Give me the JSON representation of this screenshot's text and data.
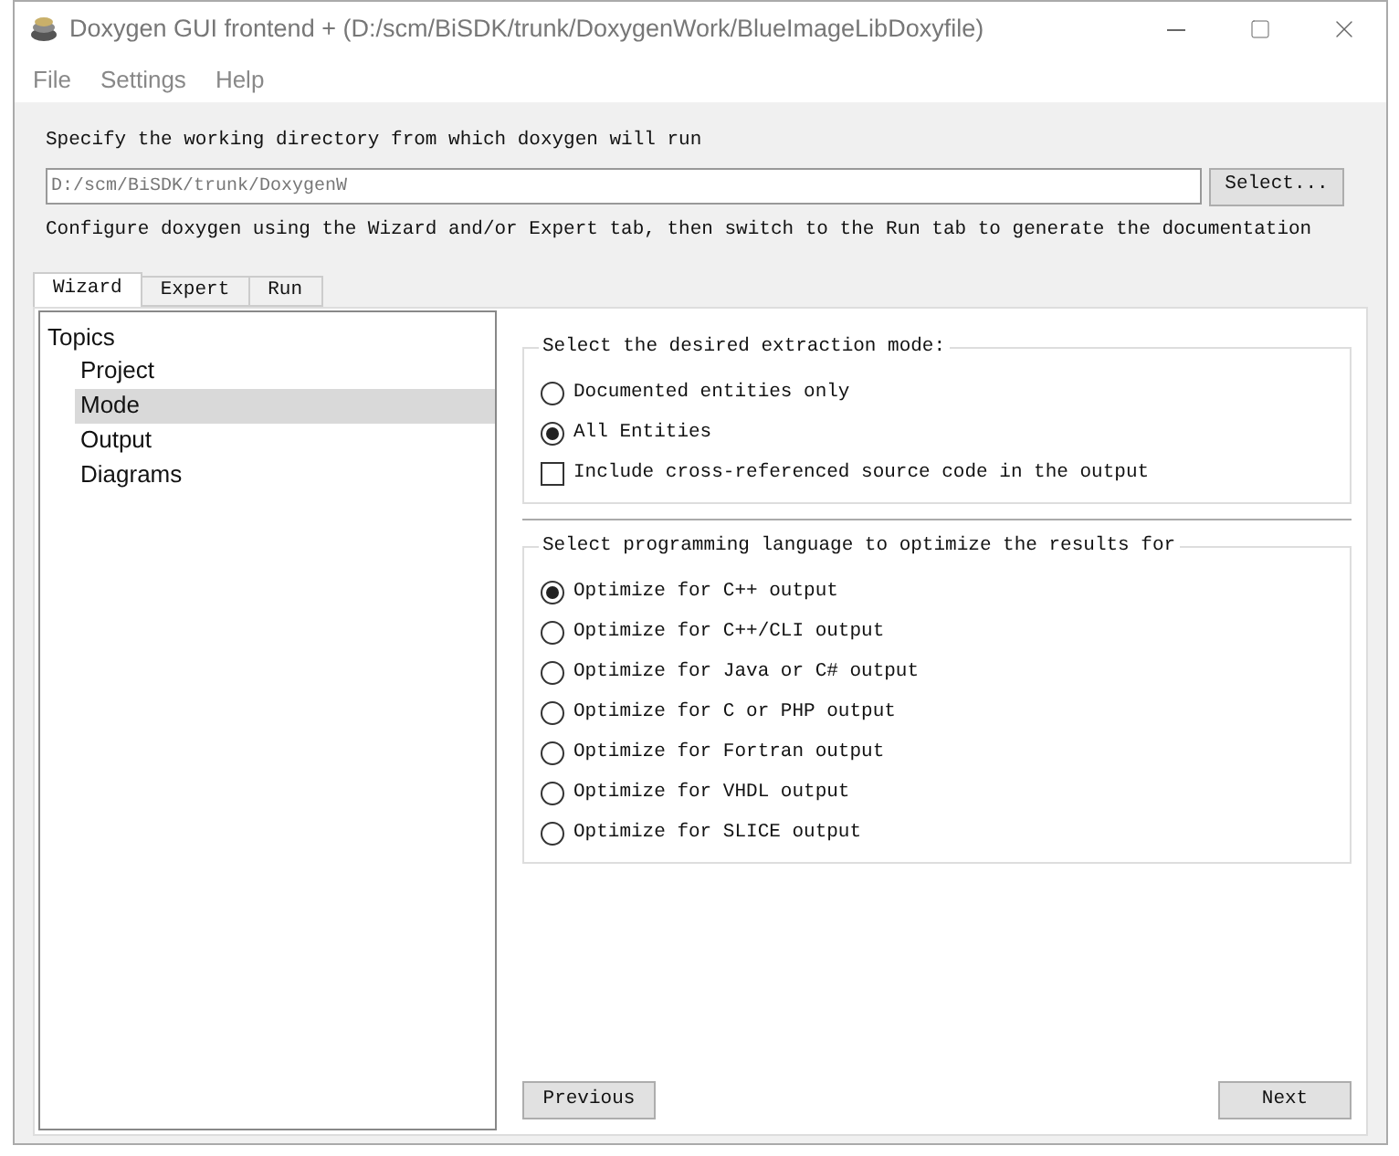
{
  "window": {
    "title": "Doxygen GUI frontend + (D:/scm/BiSDK/trunk/DoxygenWork/BlueImageLibDoxyfile)"
  },
  "menu": [
    "File",
    "Settings",
    "Help"
  ],
  "working_dir": {
    "label": "Specify the working directory from which doxygen will run",
    "value": "D:/scm/BiSDK/trunk/DoxygenW",
    "button": "Select..."
  },
  "hint": "Configure doxygen using the Wizard and/or Expert tab, then switch to the Run tab to generate the documentation",
  "tabs": [
    {
      "label": "Wizard",
      "selected": true
    },
    {
      "label": "Expert",
      "selected": false
    },
    {
      "label": "Run",
      "selected": false
    }
  ],
  "topics": {
    "title": "Topics",
    "items": [
      {
        "label": "Project",
        "selected": false
      },
      {
        "label": "Mode",
        "selected": true
      },
      {
        "label": "Output",
        "selected": false
      },
      {
        "label": "Diagrams",
        "selected": false
      }
    ]
  },
  "groups": [
    {
      "title": "Select the desired extraction mode:",
      "options": [
        {
          "kind": "radio",
          "label": "Documented entities only",
          "checked": false
        },
        {
          "kind": "radio",
          "label": "All Entities",
          "checked": true
        },
        {
          "kind": "checkbox",
          "label": "Include cross-referenced source code in the output",
          "checked": false
        }
      ]
    },
    {
      "title": "Select programming language to optimize the results for",
      "options": [
        {
          "kind": "radio",
          "label": "Optimize for C++ output",
          "checked": true
        },
        {
          "kind": "radio",
          "label": "Optimize for C++/CLI output",
          "checked": false
        },
        {
          "kind": "radio",
          "label": "Optimize for Java or C# output",
          "checked": false
        },
        {
          "kind": "radio",
          "label": "Optimize for C or PHP output",
          "checked": false
        },
        {
          "kind": "radio",
          "label": "Optimize for Fortran output",
          "checked": false
        },
        {
          "kind": "radio",
          "label": "Optimize for VHDL output",
          "checked": false
        },
        {
          "kind": "radio",
          "label": "Optimize for SLICE output",
          "checked": false
        }
      ]
    }
  ],
  "nav": {
    "previous": "Previous",
    "next": "Next"
  }
}
